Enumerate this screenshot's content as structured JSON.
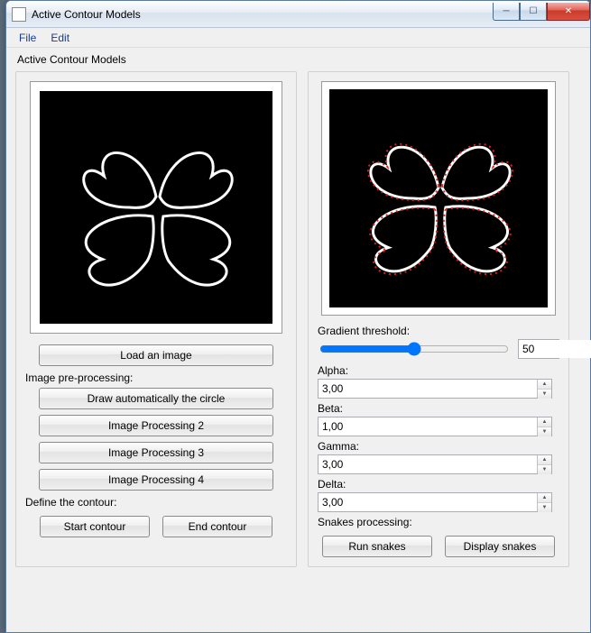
{
  "window": {
    "title": "Active Contour Models"
  },
  "menu": {
    "file": "File",
    "edit": "Edit"
  },
  "subtitle": "Active Contour Models",
  "left": {
    "load_btn": "Load an image",
    "preproc_label": "Image pre-processing:",
    "draw_circle": "Draw automatically the circle",
    "proc2": "Image Processing 2",
    "proc3": "Image Processing 3",
    "proc4": "Image Processing 4",
    "define_label": "Define the contour:",
    "start_btn": "Start contour",
    "end_btn": "End contour"
  },
  "right": {
    "grad_label": "Gradient threshold:",
    "grad_value": "50",
    "alpha_label": "Alpha:",
    "alpha_value": "3,00",
    "beta_label": "Beta:",
    "beta_value": "1,00",
    "gamma_label": "Gamma:",
    "gamma_value": "3,00",
    "delta_label": "Delta:",
    "delta_value": "3,00",
    "snakes_label": "Snakes processing:",
    "run_btn": "Run snakes",
    "display_btn": "Display snakes"
  }
}
